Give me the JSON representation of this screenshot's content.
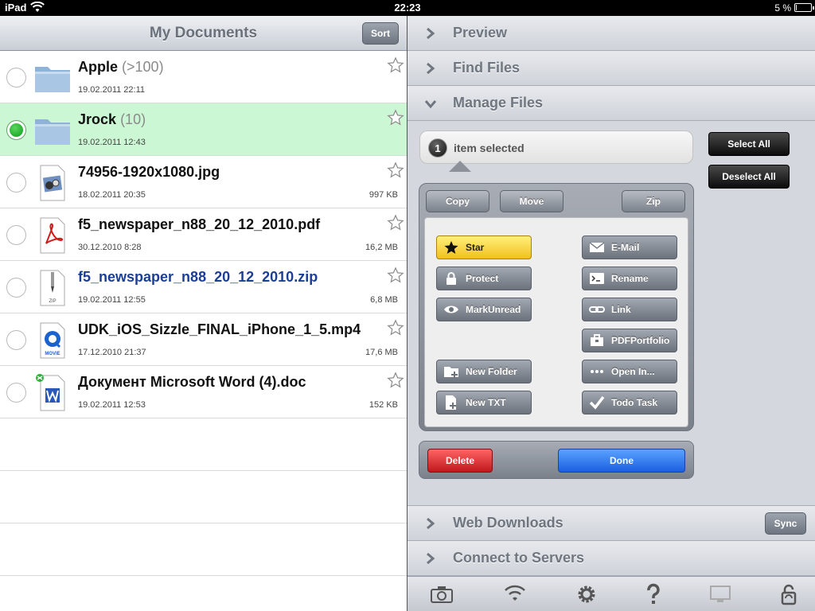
{
  "status": {
    "device": "iPad",
    "time": "22:23",
    "battery": "5 %",
    "battery_level": 0.05
  },
  "left": {
    "title": "My Documents",
    "sort_label": "Sort",
    "files": [
      {
        "name": "Apple",
        "count": "(>100)",
        "date": "19.02.2011 22:11",
        "size": "",
        "type": "folder",
        "selected": false
      },
      {
        "name": "Jrock",
        "count": "(10)",
        "date": "19.02.2011 12:43",
        "size": "",
        "type": "folder",
        "selected": true
      },
      {
        "name": "74956-1920x1080.jpg",
        "count": "",
        "date": "18.02.2011 20:35",
        "size": "997 KB",
        "type": "image",
        "selected": false
      },
      {
        "name": "f5_newspaper_n88_20_12_2010.pdf",
        "count": "",
        "date": "30.12.2010 8:28",
        "size": "16,2 MB",
        "type": "pdf",
        "selected": false
      },
      {
        "name": "f5_newspaper_n88_20_12_2010.zip",
        "count": "",
        "date": "19.02.2011 12:55",
        "size": "6,8 MB",
        "type": "zip",
        "selected": false
      },
      {
        "name": "UDK_iOS_Sizzle_FINAL_iPhone_1_5.mp4",
        "count": "",
        "date": "17.12.2010 21:37",
        "size": "17,6 MB",
        "type": "movie",
        "selected": false
      },
      {
        "name": "Документ Microsoft Word (4).doc",
        "count": "",
        "date": "19.02.2011 12:53",
        "size": "152 KB",
        "type": "word",
        "selected": false
      }
    ],
    "zip_icon_text": "ZIP",
    "movie_icon_text": "MOVIE"
  },
  "right": {
    "sections": {
      "preview": "Preview",
      "find": "Find Files",
      "manage": "Manage Files",
      "web": "Web Downloads",
      "servers": "Connect to Servers"
    },
    "sync_label": "Sync",
    "manage": {
      "selected_count": "1",
      "selected_text": "item selected",
      "select_all": "Select All",
      "deselect_all": "Deselect All",
      "copy": "Copy",
      "move": "Move",
      "zip": "Zip",
      "actions_left": [
        "Star",
        "Protect",
        "MarkUnread",
        "New Folder",
        "New TXT"
      ],
      "actions_right": [
        "E-Mail",
        "Rename",
        "Link",
        "PDFPortfolio",
        "Open In...",
        "Todo Task"
      ],
      "delete": "Delete",
      "done": "Done"
    },
    "tabs": [
      "camera-icon",
      "wifi-icon",
      "gear-icon",
      "help-icon",
      "monitor-icon",
      "lock-sync-icon"
    ]
  },
  "colors": {
    "selected_row": "#ccf7d4",
    "done": "#1b5fe0",
    "delete": "#c0181c",
    "star": "#f2c01e",
    "link_blue": "#1c3f94"
  }
}
